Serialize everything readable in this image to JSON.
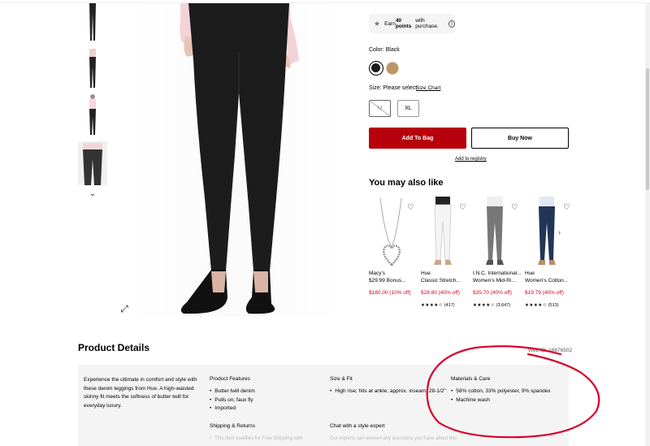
{
  "points": {
    "prefix": "Earn ",
    "bold": "40 points",
    "suffix": " with purchase."
  },
  "color": {
    "label": "Color: Black"
  },
  "size": {
    "label": "Size: Please select",
    "chart_link": "Size Chart",
    "options": [
      {
        "label": "M",
        "available": false
      },
      {
        "label": "XL",
        "available": true
      }
    ]
  },
  "actions": {
    "add_to_bag": "Add To Bag",
    "buy_now": "Buy Now",
    "add_registry": "Add to registry"
  },
  "recommendations": {
    "heading": "You may also like",
    "items": [
      {
        "brand": "Macy's",
        "name": "$29.99 Bonus...",
        "price": "$180.00 (10% off)",
        "stars": "",
        "count": ""
      },
      {
        "brand": "Hue",
        "name": "Classic Stretch...",
        "price": "$28.80 (40% off)",
        "stars": "★★★★☆",
        "count": "(417)"
      },
      {
        "brand": "I.N.C. International...",
        "name": "Women's Mid-Ris...",
        "price": "$35.70 (40% off)",
        "stars": "★★★★☆",
        "count": "(3,647)"
      },
      {
        "brand": "Hue",
        "name": "Women's Cotton...",
        "price": "$19.79 (40% off)",
        "stars": "★★★★☆",
        "count": "(513)"
      }
    ]
  },
  "details": {
    "title": "Product Details",
    "web_id": "Web ID: 18876502",
    "description": "Experience the ultimate in comfort and style with these denim leggings from Hue. A high-waisted skinny fit meets the softness of butter twill for everyday luxury.",
    "features_title": "Product Features",
    "features": [
      "Butter twill denim",
      "Pulls on; faux fly",
      "Imported"
    ],
    "size_fit_title": "Size & Fit",
    "size_fit": [
      "High rise; hits at ankle; approx. inseam: 28-1/2\""
    ],
    "materials_title": "Materials & Care",
    "materials": [
      "58% cotton, 33% polyester, 9% spandex",
      "Machine wash"
    ],
    "shipping_title": "Shipping & Returns",
    "shipping_text": "This item qualifies for Free Shipping with",
    "chat_title": "Chat with a style expert",
    "chat_text": "Our experts can answer any questions you have about this"
  },
  "colors": {
    "brand_red": "#b6000b",
    "sale_red": "#d6001c",
    "annotation": "#d8002a",
    "panel_bg": "#f4f4f4"
  },
  "icons": [
    "star-icon",
    "info-icon",
    "heart-icon",
    "chevron-down-icon",
    "chevron-right-icon",
    "expand-icon"
  ]
}
